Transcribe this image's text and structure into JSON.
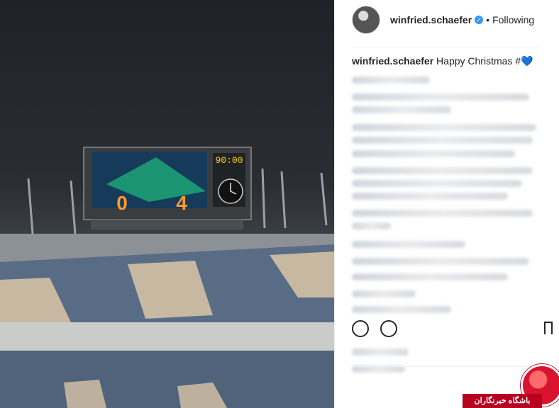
{
  "post": {
    "username": "winfried.schaefer",
    "verified_glyph": "✓",
    "separator": "•",
    "follow_status": "Following",
    "caption_user": "winfried.schaefer",
    "caption_text": "Happy Christmas #💙"
  },
  "scoreboard": {
    "clock": "90:00",
    "home_score": "0",
    "away_score": "4"
  },
  "watermark": {
    "text": "باشگاه خبرنگاران"
  },
  "colors": {
    "brand_red": "#b8001f",
    "verified_blue": "#3897f0",
    "text_dark": "#262626"
  },
  "icons": [
    "heart-icon",
    "comment-icon",
    "bookmark-icon",
    "verified-icon"
  ]
}
